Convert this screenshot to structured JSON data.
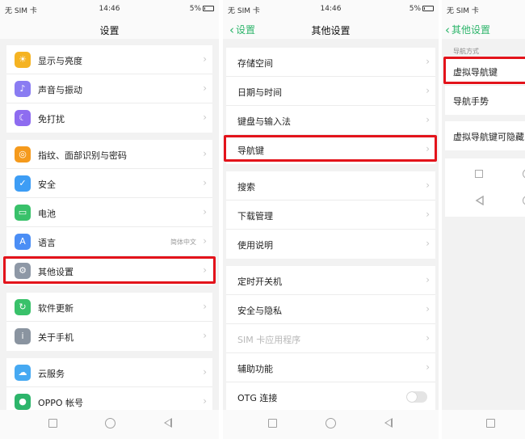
{
  "status": {
    "carrier": "无 SIM 卡",
    "time": "14:46",
    "battery": "5%"
  },
  "panel1": {
    "title": "设置",
    "groups": [
      [
        {
          "label": "显示与亮度",
          "icon": "brightness-icon"
        },
        {
          "label": "声音与振动",
          "icon": "speaker-icon"
        },
        {
          "label": "免打扰",
          "icon": "moon-icon"
        }
      ],
      [
        {
          "label": "指纹、面部识别与密码",
          "icon": "fingerprint-icon"
        },
        {
          "label": "安全",
          "icon": "shield-icon"
        },
        {
          "label": "电池",
          "icon": "battery-icon"
        },
        {
          "label": "语言",
          "icon": "language-icon",
          "value": "简体中文"
        },
        {
          "label": "其他设置",
          "icon": "gear-icon"
        }
      ],
      [
        {
          "label": "软件更新",
          "icon": "update-icon"
        },
        {
          "label": "关于手机",
          "icon": "info-icon"
        }
      ],
      [
        {
          "label": "云服务",
          "icon": "cloud-icon"
        },
        {
          "label": "OPPO 帐号",
          "icon": "account-icon"
        }
      ]
    ]
  },
  "panel2": {
    "back": "设置",
    "title": "其他设置",
    "groups": [
      [
        {
          "label": "存储空间"
        },
        {
          "label": "日期与时间"
        },
        {
          "label": "键盘与输入法"
        },
        {
          "label": "导航键"
        }
      ],
      [
        {
          "label": "搜索"
        },
        {
          "label": "下载管理"
        },
        {
          "label": "使用说明"
        }
      ],
      [
        {
          "label": "定时开关机"
        },
        {
          "label": "安全与隐私"
        },
        {
          "label": "SIM 卡应用程序",
          "disabled": true
        },
        {
          "label": "辅助功能"
        },
        {
          "label": "OTG 连接",
          "toggle": false
        }
      ]
    ]
  },
  "panel3": {
    "back": "其他设置",
    "section_caption": "导航方式",
    "options": [
      "虚拟导航键",
      "导航手势"
    ],
    "hide_option": "虚拟导航键可隐藏"
  },
  "colors": {
    "accent": "#2db56b",
    "highlight": "#e3131b"
  }
}
